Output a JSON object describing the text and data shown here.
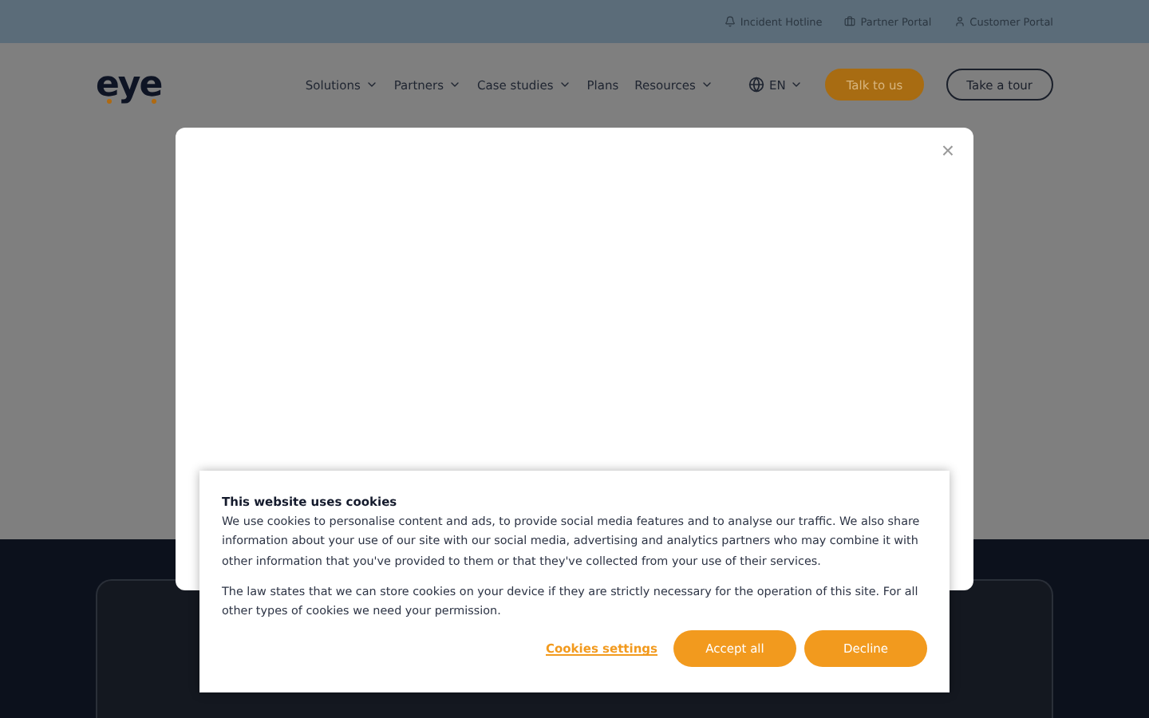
{
  "top_bar": {
    "links": [
      {
        "label": "Incident Hotline"
      },
      {
        "label": "Partner Portal"
      },
      {
        "label": "Customer Portal"
      }
    ]
  },
  "header": {
    "logo": "eye",
    "nav": [
      {
        "label": "Solutions",
        "dropdown": true
      },
      {
        "label": "Partners",
        "dropdown": true
      },
      {
        "label": "Case studies",
        "dropdown": true
      },
      {
        "label": "Plans",
        "dropdown": false
      },
      {
        "label": "Resources",
        "dropdown": true
      }
    ],
    "language": "EN",
    "buttons": [
      {
        "label": "Talk to us",
        "kind": "primary"
      },
      {
        "label": "Take a tour",
        "kind": "outline"
      }
    ]
  },
  "modal": {
    "close": "×"
  },
  "cookie_banner": {
    "title": "This website uses cookies",
    "paragraphs": [
      "We use cookies to personalise content and ads, to provide social media features and to analyse our traffic. We also share information about your use of our site with our social media, advertising and analytics partners who may combine it with other information that you've provided to them or that they've collected from your use of their services.",
      "The law states that we can store cookies on your device if they are strictly necessary for the operation of this site. For all other types of cookies we need your permission."
    ],
    "settings_link": "Cookies settings",
    "buttons": [
      "Accept all",
      "Decline"
    ]
  }
}
